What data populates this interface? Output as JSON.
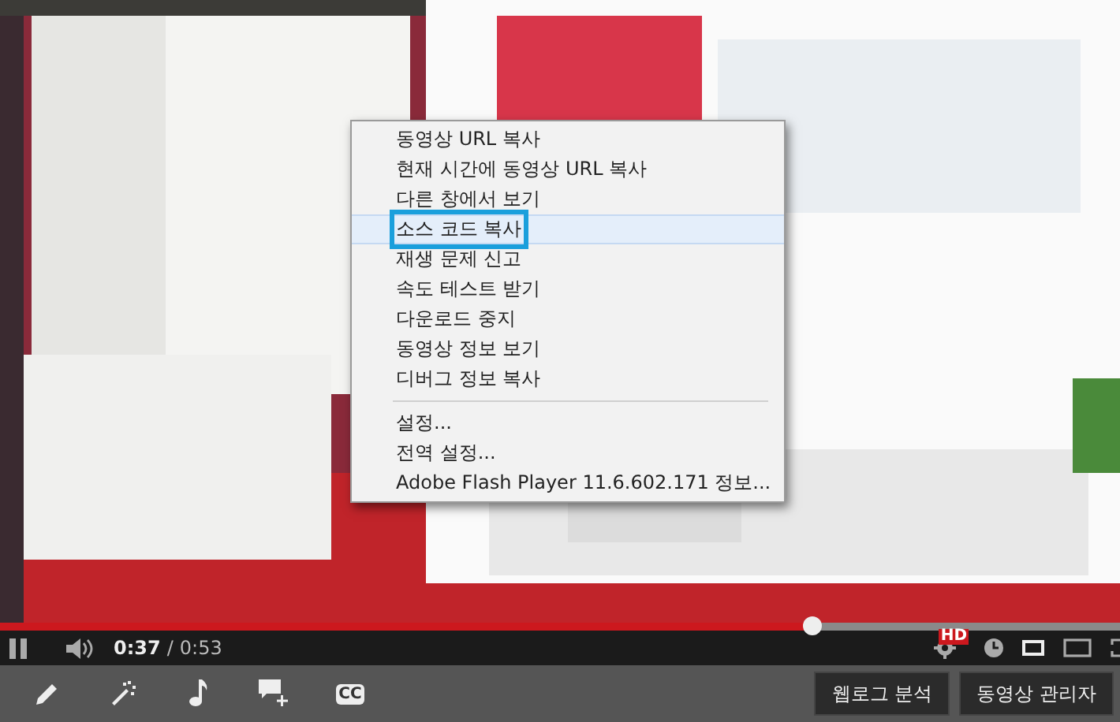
{
  "context_menu": {
    "sections": [
      {
        "items": [
          {
            "label": "동영상 URL 복사",
            "selected": false
          },
          {
            "label": "현재 시간에 동영상 URL 복사",
            "selected": false
          },
          {
            "label": "다른 창에서 보기",
            "selected": false
          },
          {
            "label": "소스 코드 복사",
            "selected": true
          },
          {
            "label": "재생 문제 신고",
            "selected": false
          },
          {
            "label": "속도 테스트 받기",
            "selected": false
          },
          {
            "label": "다운로드 중지",
            "selected": false
          },
          {
            "label": "동영상 정보 보기",
            "selected": false
          },
          {
            "label": "디버그 정보 복사",
            "selected": false
          }
        ]
      },
      {
        "items": [
          {
            "label": "설정...",
            "selected": false
          },
          {
            "label": "전역 설정...",
            "selected": false
          },
          {
            "label": "Adobe Flash Player 11.6.602.171 정보...",
            "selected": false
          }
        ]
      }
    ]
  },
  "player": {
    "progress": {
      "level": 0.725
    },
    "playing": true,
    "elapsed": "0:37",
    "time_separator": "/",
    "duration": "0:53",
    "quality_badge": "HD"
  },
  "toolbar": {
    "tools": [
      {
        "kind": "pencil"
      },
      {
        "kind": "wand"
      },
      {
        "kind": "music"
      },
      {
        "kind": "annotation"
      },
      {
        "kind": "captions",
        "label": "CC"
      }
    ],
    "buttons": [
      "웹로그 분석",
      "동영상 관리자"
    ]
  }
}
